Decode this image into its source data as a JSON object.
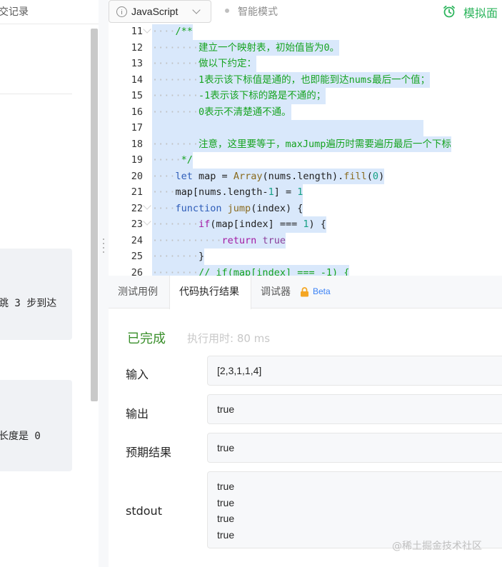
{
  "left_panel": {
    "tab_label": "交记录",
    "example1_text": "跳 3 步到达",
    "example2_text": "长度是 0"
  },
  "toolbar": {
    "language": "JavaScript",
    "smart_mode": "智能模式",
    "mock_interview": "模拟面",
    "info_icon": "info-icon",
    "dropdown_icon": "chevron-down-icon",
    "alarm_icon": "alarm-clock-icon"
  },
  "editor": {
    "line_numbers": [
      "11",
      "12",
      "13",
      "14",
      "15",
      "16",
      "17",
      "18",
      "19",
      "20",
      "21",
      "22",
      "23",
      "24",
      "25",
      "26"
    ],
    "lines": [
      "/**",
      "建立一个映射表，初始值皆为0。",
      "做以下约定：",
      "1表示该下标值是通的，也即能到达nums最后一个值；",
      "-1表示该下标的路是不通的；",
      "0表示不清楚通不通。",
      "",
      "注意，这里要等于，maxJump遍历时需要遍历最后一个下标",
      "*/",
      "let map = Array(nums.length).fill(0)",
      "map[nums.length-1] = 1",
      "function jump(index) {",
      "if(map[index] === 1) {",
      "return true",
      "}",
      "// if(map[index] === -1) {"
    ]
  },
  "result": {
    "tabs": [
      "测试用例",
      "代码执行结果",
      "调试器"
    ],
    "beta": "Beta",
    "status": "已完成",
    "runtime": "执行用时: 80 ms",
    "input_label": "输入",
    "input_value": "[2,3,1,1,4]",
    "output_label": "输出",
    "output_value": "true",
    "expected_label": "预期结果",
    "expected_value": "true",
    "stdout_label": "stdout",
    "stdout_lines": [
      "true",
      "true",
      "true",
      "true"
    ]
  },
  "watermark": "@稀土掘金技术社区",
  "colors": {
    "accent_green": "#2db55d",
    "status_green": "#3a8f2b",
    "selection": "#d9e8fb",
    "comment": "#16a320",
    "keyword": "#a31aa3"
  }
}
